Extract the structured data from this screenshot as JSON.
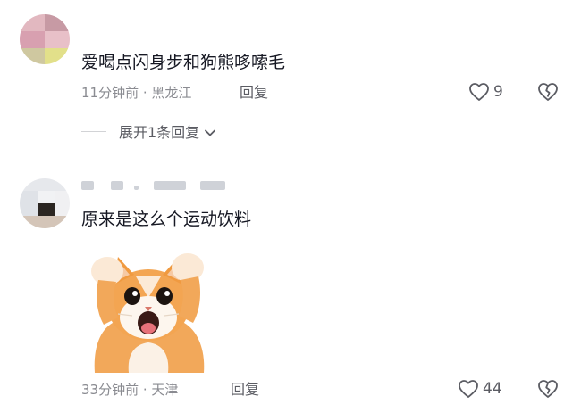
{
  "comments": [
    {
      "text": "爱喝点闪身步和狗熊哆嗦毛",
      "time": "11分钟前",
      "location": "黑龙江",
      "reply_label": "回复",
      "likes": "9",
      "expand_label": "展开1条回复",
      "avatar_colors": [
        "#e2b8c0",
        "#c79aa4",
        "#d8a0b0",
        "#e8c0c8",
        "#cfc8a0",
        "#e2e08a"
      ]
    },
    {
      "text": "原来是这么个运动饮料",
      "time": "33分钟前",
      "location": "天津",
      "reply_label": "回复",
      "likes": "44",
      "avatar_colors": [
        "#e6e8ec",
        "#dfe2e7",
        "#f1f2f4",
        "#2b2622",
        "#f0f0f2",
        "#d4c5b8"
      ]
    }
  ],
  "sticker": {
    "icon": "cat-sticker"
  },
  "colors": {
    "text": "#161823",
    "meta": "#8a8b91",
    "icon": "#5b5c63"
  }
}
